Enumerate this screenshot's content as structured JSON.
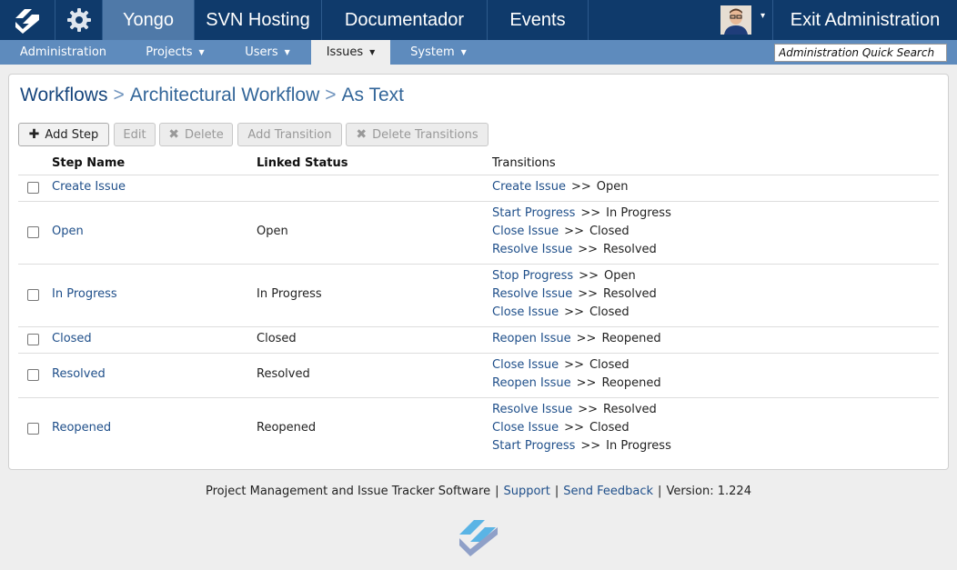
{
  "topnav": {
    "tabs": [
      {
        "label": "Yongo",
        "active": true
      },
      {
        "label": "SVN Hosting",
        "active": false
      },
      {
        "label": "Documentador",
        "active": false
      },
      {
        "label": "Events",
        "active": false
      }
    ],
    "exit_label": "Exit Administration"
  },
  "subnav": {
    "items": [
      {
        "label": "Administration",
        "dropdown": false,
        "active": false
      },
      {
        "label": "Projects",
        "dropdown": true,
        "active": false
      },
      {
        "label": "Users",
        "dropdown": true,
        "active": false
      },
      {
        "label": "Issues",
        "dropdown": true,
        "active": true
      },
      {
        "label": "System",
        "dropdown": true,
        "active": false
      }
    ],
    "search_placeholder": "Administration Quick Search"
  },
  "breadcrumb": {
    "root": "Workflows",
    "workflow": "Architectural Workflow",
    "current": "As Text",
    "separator": ">"
  },
  "toolbar": {
    "add_step": "Add Step",
    "edit": "Edit",
    "delete": "Delete",
    "add_transition": "Add Transition",
    "delete_transitions": "Delete Transitions"
  },
  "table": {
    "headers": {
      "step_name": "Step Name",
      "linked_status": "Linked Status",
      "transitions": "Transitions"
    },
    "arrow": ">>",
    "rows": [
      {
        "step": "Create Issue",
        "status": "",
        "transitions": [
          {
            "name": "Create Issue",
            "target": "Open"
          }
        ]
      },
      {
        "step": "Open",
        "status": "Open",
        "transitions": [
          {
            "name": "Start Progress",
            "target": "In Progress"
          },
          {
            "name": "Close Issue",
            "target": "Closed"
          },
          {
            "name": "Resolve Issue",
            "target": "Resolved"
          }
        ]
      },
      {
        "step": "In Progress",
        "status": "In Progress",
        "transitions": [
          {
            "name": "Stop Progress",
            "target": "Open"
          },
          {
            "name": "Resolve Issue",
            "target": "Resolved"
          },
          {
            "name": "Close Issue",
            "target": "Closed"
          }
        ]
      },
      {
        "step": "Closed",
        "status": "Closed",
        "transitions": [
          {
            "name": "Reopen Issue",
            "target": "Reopened"
          }
        ]
      },
      {
        "step": "Resolved",
        "status": "Resolved",
        "transitions": [
          {
            "name": "Close Issue",
            "target": "Closed"
          },
          {
            "name": "Reopen Issue",
            "target": "Reopened"
          }
        ]
      },
      {
        "step": "Reopened",
        "status": "Reopened",
        "transitions": [
          {
            "name": "Resolve Issue",
            "target": "Resolved"
          },
          {
            "name": "Close Issue",
            "target": "Closed"
          },
          {
            "name": "Start Progress",
            "target": "In Progress"
          }
        ]
      }
    ]
  },
  "footer": {
    "product": "Project Management and Issue Tracker Software",
    "support": "Support",
    "feedback": "Send Feedback",
    "version": "Version: 1.224"
  },
  "colors": {
    "topbar": "#0f3a6b",
    "active_tab": "#4f79a8",
    "subbar": "#5e8bbd",
    "link": "#1f4f8a"
  }
}
